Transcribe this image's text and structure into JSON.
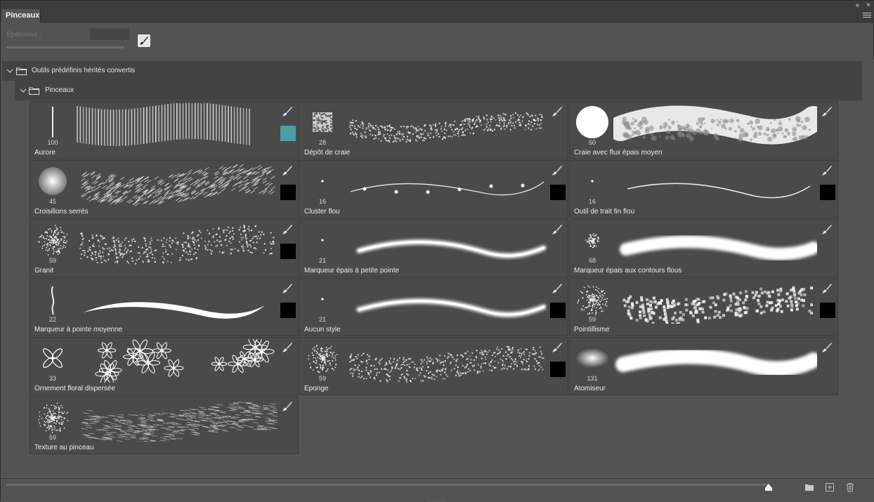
{
  "window": {
    "collapse_glyph": "«",
    "close_glyph": "×"
  },
  "tab": {
    "label": "Pinceaux"
  },
  "size": {
    "label": "Epaisseur :",
    "value": ""
  },
  "groups": [
    {
      "label": "Outils prédéfinis hérités convertis"
    },
    {
      "label": "Pinceaux"
    }
  ],
  "brushes": [
    {
      "name": "Aurore",
      "size": "100",
      "swatch": "#4a9ea5",
      "tip": "line",
      "stroke": "bristle"
    },
    {
      "name": "Dépôt de craie",
      "size": "28",
      "swatch": "",
      "tip": "chalk",
      "stroke": "chalk"
    },
    {
      "name": "Craie avec flux épais moyen",
      "size": "50",
      "swatch": "",
      "tip": "disc",
      "stroke": "thickchalk"
    },
    {
      "name": "Croisillons serrés",
      "size": "45",
      "swatch": "#000000",
      "tip": "soft",
      "stroke": "hatch"
    },
    {
      "name": "Cluster flou",
      "size": "16",
      "swatch": "#000000",
      "tip": "dot",
      "stroke": "cluster"
    },
    {
      "name": "Outil de trait fin flou",
      "size": "16",
      "swatch": "#000000",
      "tip": "dot",
      "stroke": "thin"
    },
    {
      "name": "Granit",
      "size": "59",
      "swatch": "#000000",
      "tip": "speckle",
      "stroke": "granite"
    },
    {
      "name": "Marqueur épais à petite pointe",
      "size": "21",
      "swatch": "",
      "tip": "dot",
      "stroke": "marker"
    },
    {
      "name": "Marqueur épais aux contours flous",
      "size": "68",
      "swatch": "",
      "tip": "fuzzy",
      "stroke": "fuzzymarker"
    },
    {
      "name": "Marqueur à pointe moyenne",
      "size": "22",
      "swatch": "#000000",
      "tip": "squiggle",
      "stroke": "taper"
    },
    {
      "name": "Aucun style",
      "size": "21",
      "swatch": "#000000",
      "tip": "dot",
      "stroke": "marker"
    },
    {
      "name": "Pointillisme",
      "size": "59",
      "swatch": "#000000",
      "tip": "speckle",
      "stroke": "pointillism"
    },
    {
      "name": "Ornement floral dispersée",
      "size": "33",
      "swatch": "",
      "tip": "flower",
      "stroke": "floral"
    },
    {
      "name": "Eponge",
      "size": "59",
      "swatch": "#000000",
      "tip": "speckle",
      "stroke": "sponge"
    },
    {
      "name": "Atomiseur",
      "size": "131",
      "swatch": "",
      "tip": "softwide",
      "stroke": "airbrush"
    },
    {
      "name": "Texture au pinceau",
      "size": "59",
      "swatch": "",
      "tip": "speckle",
      "stroke": "texture"
    }
  ],
  "preview_slider_value": 0.95,
  "footer": {
    "buttons": [
      "new-group",
      "new-brush",
      "delete"
    ]
  }
}
